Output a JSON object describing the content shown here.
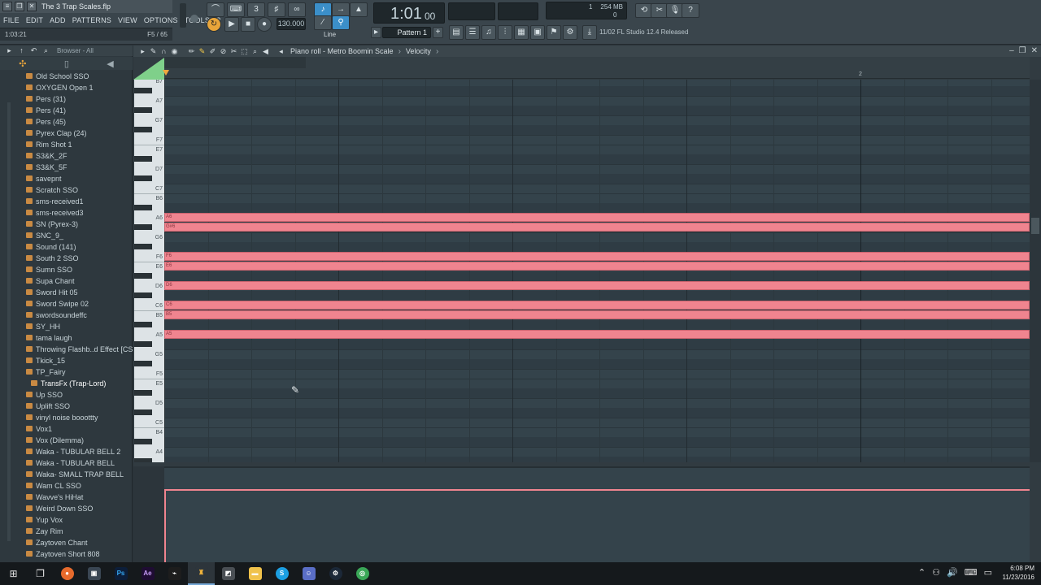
{
  "window": {
    "title": "The 3 Trap Scales.flp"
  },
  "menu": [
    "FILE",
    "EDIT",
    "ADD",
    "PATTERNS",
    "VIEW",
    "OPTIONS",
    "TOOLS",
    "?"
  ],
  "hint": {
    "time": "1:03:21",
    "note": "F5 / 65"
  },
  "transport": {
    "tempo": "130.000",
    "song_position": "1:01",
    "song_position_sub": "00",
    "pattern_label": "Pattern 1",
    "snap_label": "Line",
    "mem_top": "254 MB",
    "mem_bottom": "0",
    "cpu_val": "1",
    "news": "11/02  FL Studio 12.4 Released"
  },
  "browser": {
    "title": "Browser - All",
    "items": [
      "Old School SSO",
      "OXYGEN Open 1",
      "Pers (31)",
      "Pers (41)",
      "Pers (45)",
      "Pyrex Clap (24)",
      "Rim Shot 1",
      "S3&K_2F",
      "S3&K_5F",
      "savepnt",
      "Scratch SSO",
      "sms-received1",
      "sms-received3",
      "SN (Pyrex-3)",
      "SNC_9_",
      "Sound (141)",
      "South 2 SSO",
      "Sumn SSO",
      "Supa Chant",
      "Sword Hit 05",
      "Sword Swipe 02",
      "swordsoundeffc",
      "SY_HH",
      "tama laugh",
      "Throwing Flashb..d Effect [CS-GO]",
      "Tkick_15",
      "TP_Fairy",
      "TransFx (Trap-Lord)",
      "Up SSO",
      "Uplift SSO",
      "vinyl noise booottty",
      "Vox1",
      "Vox (Dilemma)",
      "Waka - TUBULAR BELL 2",
      "Waka - TUBULAR BELL",
      "Waka- SMALL TRAP BELL",
      "Wam CL SSO",
      "Wavve's HiHat",
      "Weird Down SSO",
      "Yup Vox",
      "Zay Rim",
      "Zaytoven Chant",
      "Zaytoven Short 808"
    ],
    "selected_index": 27
  },
  "piano_roll": {
    "title": "Piano roll - Metro Boomin Scale",
    "target": "Velocity",
    "bar_marker": "2",
    "key_labels": [
      "B7",
      "A7",
      "G7",
      "F7",
      "E7",
      "D7",
      "C7",
      "B6",
      "A6",
      "G6",
      "F6",
      "E6",
      "D6",
      "C6",
      "B5",
      "A5",
      "G5",
      "F5",
      "E5",
      "D5",
      "C5",
      "B4",
      "A4"
    ],
    "notes": [
      {
        "pitch": "A6",
        "label": "A6"
      },
      {
        "pitch": "G#6",
        "label": "G#6"
      },
      {
        "pitch": "F6",
        "label": "F6"
      },
      {
        "pitch": "E6",
        "label": "E6"
      },
      {
        "pitch": "D6",
        "label": "D6"
      },
      {
        "pitch": "C6",
        "label": "C6"
      },
      {
        "pitch": "B5",
        "label": "B5"
      },
      {
        "pitch": "A5",
        "label": "A5"
      }
    ]
  },
  "clock": {
    "time": "6:08 PM",
    "date": "11/23/2016"
  }
}
